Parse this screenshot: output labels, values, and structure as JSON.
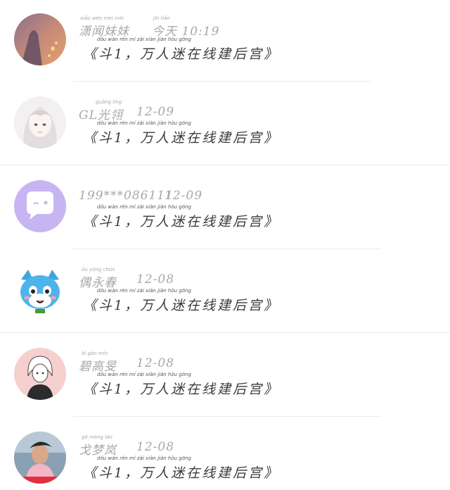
{
  "items": [
    {
      "name": "潇闻妹妹",
      "name_pinyin": "xiāo wén mèi mèi",
      "time": "今天 10:19",
      "time_pinyin": "jīn tiān",
      "message": "《斗1，万人迷在线建后宫》",
      "message_pinyin": "dǒu  wàn rén mí zài xiàn jiàn hòu gōng",
      "avatar": "sunset-girl-avatar"
    },
    {
      "name": "GL光翎",
      "name_pinyin": "guāng líng",
      "time": "12-09",
      "message": "《斗1，万人迷在线建后宫》",
      "message_pinyin": "dǒu  wàn rén mí zài xiàn jiàn hòu gōng",
      "avatar": "white-hair-anime-avatar"
    },
    {
      "name": "199***086111",
      "time": "12-09",
      "message": "《斗1，万人迷在线建后宫》",
      "message_pinyin": "dǒu  wàn rén mí zài xiàn jiàn hòu gōng",
      "avatar": "chat-bubble-default-avatar"
    },
    {
      "name": "偶永春",
      "name_pinyin": "ǒu yǒng chūn",
      "time": "12-08",
      "message": "《斗1，万人迷在线建后宫》",
      "message_pinyin": "dǒu  wàn rén mí zài xiàn jiàn hòu gōng",
      "avatar": "blue-cat-avatar"
    },
    {
      "name": "碧高旻",
      "name_pinyin": "bì gāo mín",
      "time": "12-08",
      "message": "《斗1，万人迷在线建后宫》",
      "message_pinyin": "dǒu  wàn rén mí zài xiàn jiàn hòu gōng",
      "avatar": "sketch-girl-avatar"
    },
    {
      "name": "戈梦岚",
      "name_pinyin": "gē mèng lán",
      "time": "12-08",
      "message": "《斗1，万人迷在线建后宫》",
      "message_pinyin": "dǒu  wàn rén mí zài xiàn jiàn hòu gōng",
      "avatar": "boy-photo-avatar"
    }
  ]
}
